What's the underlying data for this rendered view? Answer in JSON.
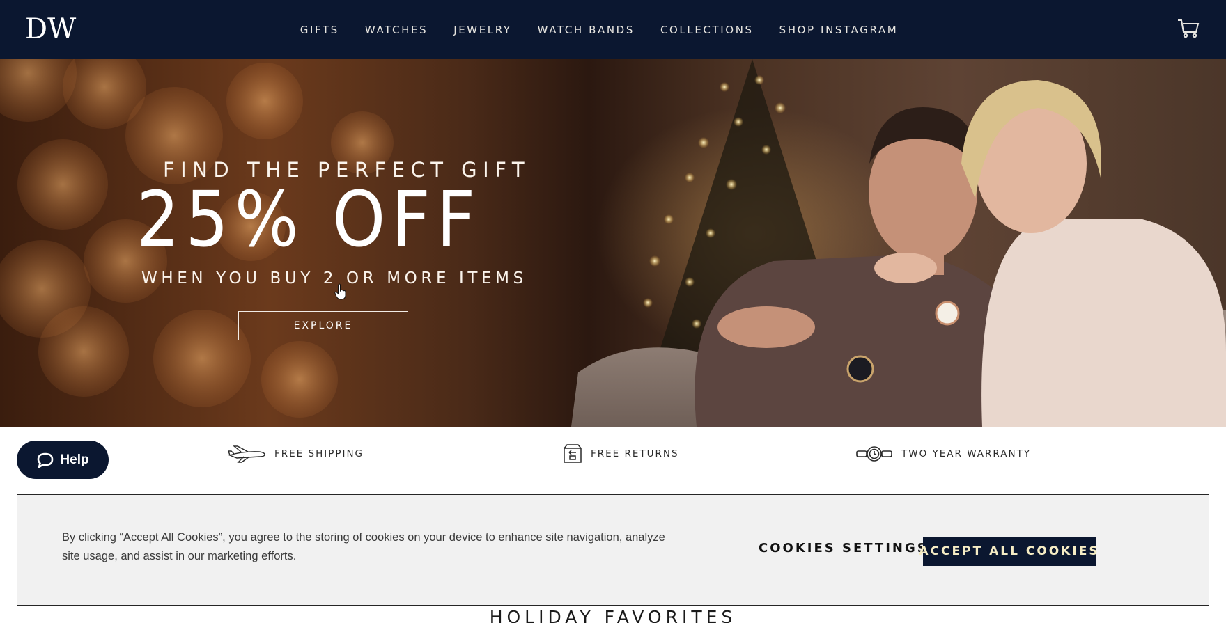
{
  "header": {
    "logo_text": "DW",
    "nav": [
      {
        "label": "GIFTS"
      },
      {
        "label": "WATCHES"
      },
      {
        "label": "JEWELRY"
      },
      {
        "label": "WATCH BANDS"
      },
      {
        "label": "COLLECTIONS"
      },
      {
        "label": "SHOP INSTAGRAM"
      }
    ],
    "cart_icon": "cart-icon"
  },
  "hero": {
    "eyebrow": "FIND THE PERFECT GIFT",
    "headline": "25% OFF",
    "subline": "WHEN YOU BUY 2 OR MORE ITEMS",
    "cta_label": "EXPLORE"
  },
  "benefits": {
    "help_label": "Help",
    "items": [
      {
        "label": "FREE SHIPPING",
        "icon": "airplane-icon"
      },
      {
        "label": "FREE RETURNS",
        "icon": "return-box-icon"
      },
      {
        "label": "TWO YEAR WARRANTY",
        "icon": "watch-icon"
      }
    ]
  },
  "section": {
    "holiday_title": "HOLIDAY FAVORITES"
  },
  "cookie_banner": {
    "text": "By clicking “Accept All Cookies”, you agree to the storing of cookies on your device to enhance site navigation, analyze site usage, and assist in our marketing efforts.",
    "settings_label": "COOKIES SETTINGS",
    "accept_label": "ACCEPT ALL COOKIES"
  },
  "colors": {
    "navy": "#0b1730",
    "accept_text": "#f5ecc4",
    "banner_bg": "#f1f1f1"
  }
}
